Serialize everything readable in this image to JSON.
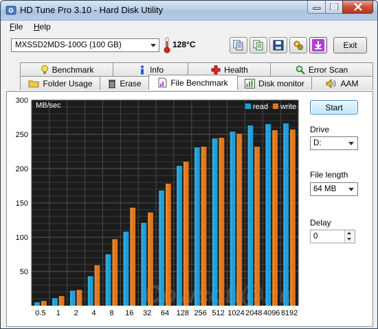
{
  "window": {
    "title": "HD Tune Pro 3.10 - Hard Disk Utility",
    "controls": {
      "minimize": "–",
      "maximize": "□",
      "close": "✕"
    }
  },
  "menu": {
    "file": "File",
    "help": "Help"
  },
  "toolbar": {
    "drive": "MXSSD2MDS-100G (100 GB)",
    "temperature": "128°C",
    "exit_label": "Exit",
    "buttons": [
      "copy-icon",
      "copy-info-icon",
      "save-icon",
      "options-icon",
      "download-icon"
    ]
  },
  "tabs_row1": [
    {
      "label": "Benchmark",
      "icon": "lightbulb-icon"
    },
    {
      "label": "Info",
      "icon": "info-icon"
    },
    {
      "label": "Health",
      "icon": "health-cross-icon"
    },
    {
      "label": "Error Scan",
      "icon": "magnifier-icon"
    }
  ],
  "tabs_row2": [
    {
      "label": "Folder Usage",
      "icon": "folder-icon"
    },
    {
      "label": "Erase",
      "icon": "trash-icon"
    },
    {
      "label": "File Benchmark",
      "icon": "file-benchmark-icon",
      "active": true
    },
    {
      "label": "Disk monitor",
      "icon": "bar-chart-icon"
    },
    {
      "label": "AAM",
      "icon": "speaker-icon"
    }
  ],
  "side_panel": {
    "start_label": "Start",
    "drive_label": "Drive",
    "drive_value": "D:",
    "file_length_label": "File length",
    "file_length_value": "64 MB",
    "delay_label": "Delay",
    "delay_value": "0"
  },
  "watermark": "Cowcotl@nd",
  "colors": {
    "read": "#1e9ed8",
    "write": "#e0771a",
    "plot_bg": "#1c1c1c"
  },
  "chart_data": {
    "type": "bar",
    "ylabel": "MB/sec",
    "ylim": [
      0,
      300
    ],
    "yticks": [
      50,
      100,
      150,
      200,
      250,
      300
    ],
    "grid": true,
    "legend_position": "top-right",
    "categories": [
      "0.5",
      "1",
      "2",
      "4",
      "8",
      "16",
      "32",
      "64",
      "128",
      "256",
      "512",
      "1024",
      "2048",
      "4096",
      "8192"
    ],
    "series": [
      {
        "name": "read",
        "values": [
          5,
          11,
          22,
          43,
          75,
          108,
          121,
          168,
          204,
          231,
          244,
          254,
          263,
          265,
          266
        ]
      },
      {
        "name": "write",
        "values": [
          7,
          14,
          23,
          59,
          97,
          143,
          136,
          178,
          210,
          232,
          245,
          251,
          232,
          256,
          257
        ]
      }
    ]
  }
}
